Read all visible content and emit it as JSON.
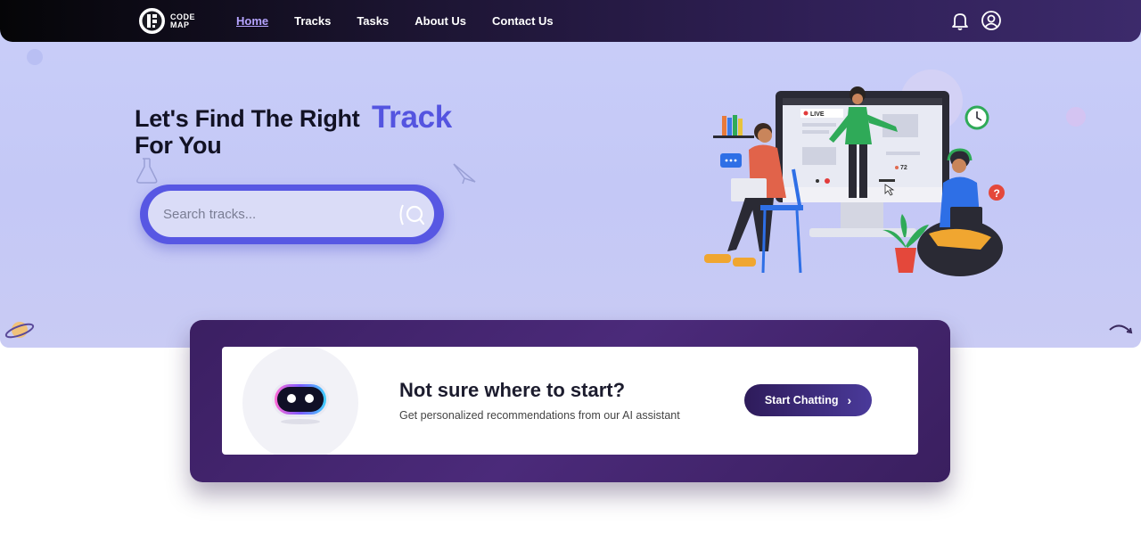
{
  "app": {
    "logo_text": "CODE MAP"
  },
  "nav": {
    "items": [
      {
        "label": "Home",
        "active": true
      },
      {
        "label": "Tracks",
        "active": false
      },
      {
        "label": "Tasks",
        "active": false
      },
      {
        "label": "About Us",
        "active": false
      },
      {
        "label": "Contact Us",
        "active": false
      }
    ],
    "icons": [
      "bell-icon",
      "user-profile-icon"
    ]
  },
  "hero": {
    "headline_line1": "Let's Find The Right",
    "headline_line2": "For You",
    "headline_accent": "Track",
    "search": {
      "placeholder": "Search tracks...",
      "value": ""
    },
    "illustration": {
      "live_badge": "LIVE",
      "viewer_count": "72"
    }
  },
  "chat_cta": {
    "title": "Not sure where to start?",
    "subtitle": "Get personalized recommendations from our AI assistant",
    "button_label": "Start Chatting",
    "button_icon": "chevron-right-icon"
  },
  "colors": {
    "accent": "#5454e0",
    "nav_bg_start": "#050507",
    "nav_bg_end": "#3c2a6b",
    "hero_bg": "#c7cbf7",
    "cta_bg": "#3f2268"
  }
}
